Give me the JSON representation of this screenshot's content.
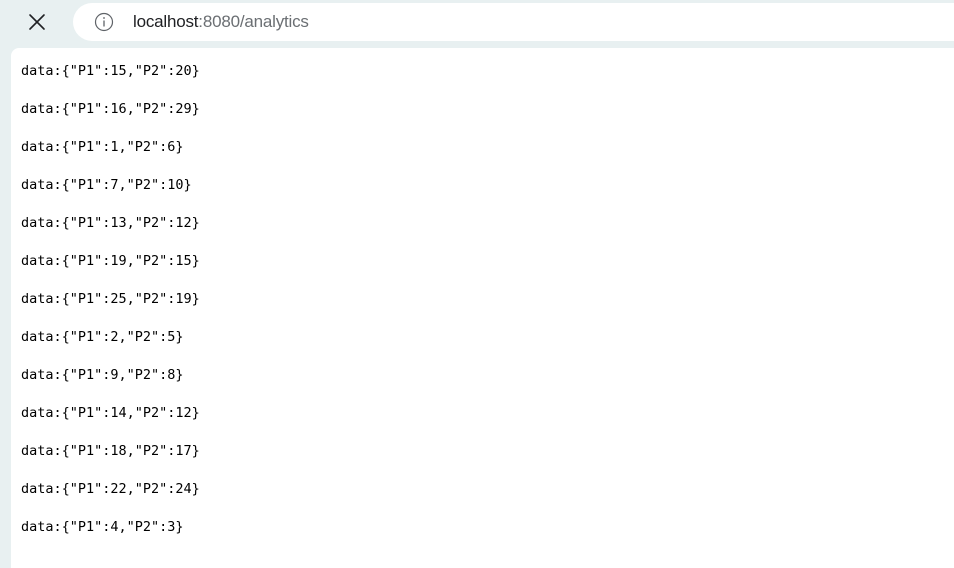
{
  "browser": {
    "close_icon": "close-icon",
    "info_icon": "info-icon",
    "url_host": "localhost",
    "url_rest": ":8080/analytics"
  },
  "lines": [
    "data:{\"P1\":15,\"P2\":20}",
    "data:{\"P1\":16,\"P2\":29}",
    "data:{\"P1\":1,\"P2\":6}",
    "data:{\"P1\":7,\"P2\":10}",
    "data:{\"P1\":13,\"P2\":12}",
    "data:{\"P1\":19,\"P2\":15}",
    "data:{\"P1\":25,\"P2\":19}",
    "data:{\"P1\":2,\"P2\":5}",
    "data:{\"P1\":9,\"P2\":8}",
    "data:{\"P1\":14,\"P2\":12}",
    "data:{\"P1\":18,\"P2\":17}",
    "data:{\"P1\":22,\"P2\":24}",
    "data:{\"P1\":4,\"P2\":3}"
  ]
}
